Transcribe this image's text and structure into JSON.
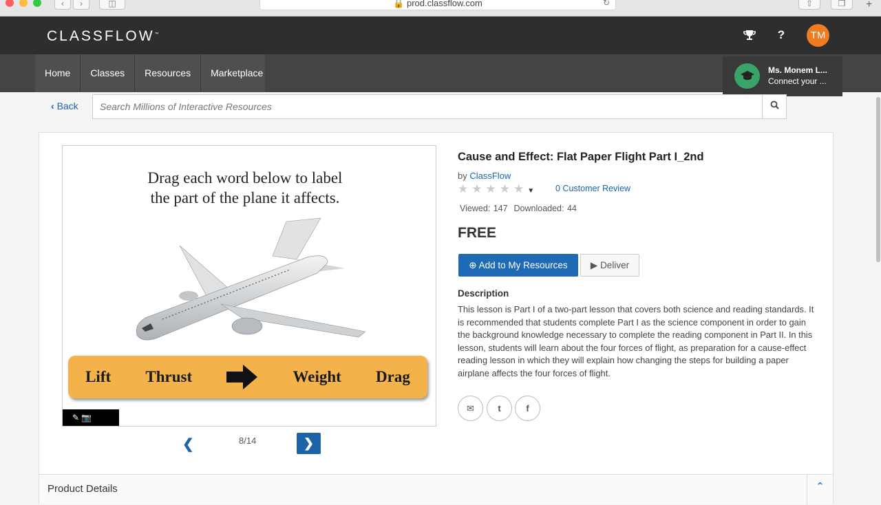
{
  "browser": {
    "url": "prod.classflow.com"
  },
  "header": {
    "logo": "CLASSFLOW",
    "logo_mark": "™",
    "avatar_initials": "TM",
    "trophy_icon": "trophy-icon",
    "help_label": "?"
  },
  "nav": {
    "items": [
      "Home",
      "Classes",
      "Resources",
      "Marketplace"
    ]
  },
  "profile_popup": {
    "name": "Ms. Monem L...",
    "subtitle": "Connect your ..."
  },
  "back_label": "Back",
  "search": {
    "placeholder": "Search Millions of Interactive Resources"
  },
  "preview": {
    "prompt_line1": "Drag each word below to label",
    "prompt_line2": "the part of the plane it affects.",
    "words": [
      "Lift",
      "Thrust",
      "Weight",
      "Drag"
    ],
    "page": "8/14"
  },
  "resource": {
    "title": "Cause and Effect: Flat Paper Flight Part I_2nd",
    "by_prefix": "by",
    "author": "ClassFlow",
    "rating": 0,
    "reviews": "0 Customer Review",
    "stats": "Viewed: 147  Downloaded: 44",
    "price": "FREE",
    "add_label": "Add to My Resources",
    "deliver_label": "Deliver",
    "description_heading": "Description",
    "description": "This lesson is Part I of a two-part lesson that covers both science and reading standards. It is recommended that students complete Part I as the science component in order to gain the background knowledge necessary to complete the reading component in Part II. In this lesson, students will learn about the four forces of flight, as preparation for a cause-effect reading lesson in which they will explain how changing the steps for building a paper airplane affects the four forces of flight."
  },
  "product_details_label": "Product Details",
  "colors": {
    "brand_blue": "#1d63a8",
    "avatar_orange": "#f07c22",
    "word_bar": "#f4b24a"
  }
}
